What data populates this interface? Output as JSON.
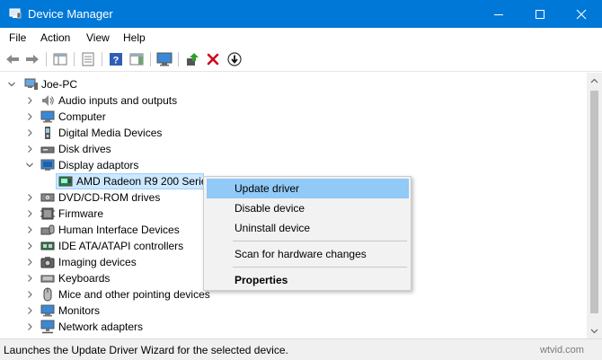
{
  "window": {
    "title": "Device Manager"
  },
  "menu": [
    "File",
    "Action",
    "View",
    "Help"
  ],
  "toolbar": {
    "icons": [
      "back-icon",
      "forward-icon",
      "show-hide-console-tree-icon",
      "properties-icon",
      "help-icon",
      "action-pane-icon",
      "monitor-icon",
      "update-driver-icon",
      "uninstall-icon",
      "disable-icon"
    ]
  },
  "tree": {
    "root": "Joe-PC",
    "items": [
      "Audio inputs and outputs",
      "Computer",
      "Digital Media Devices",
      "Disk drives",
      "Display adaptors",
      "AMD Radeon R9 200 Series",
      "DVD/CD-ROM drives",
      "Firmware",
      "Human Interface Devices",
      "IDE ATA/ATAPI controllers",
      "Imaging devices",
      "Keyboards",
      "Mice and other pointing devices",
      "Monitors",
      "Network adapters"
    ]
  },
  "context_menu": {
    "items": [
      "Update driver",
      "Disable device",
      "Uninstall device",
      "Scan for hardware changes",
      "Properties"
    ]
  },
  "status": {
    "text": "Launches the Update Driver Wizard for the selected device."
  },
  "watermark": "wtvid.com",
  "colors": {
    "titlebar": "#0078d7",
    "highlight": "#91c9f7",
    "selection": "#cce8ff"
  }
}
